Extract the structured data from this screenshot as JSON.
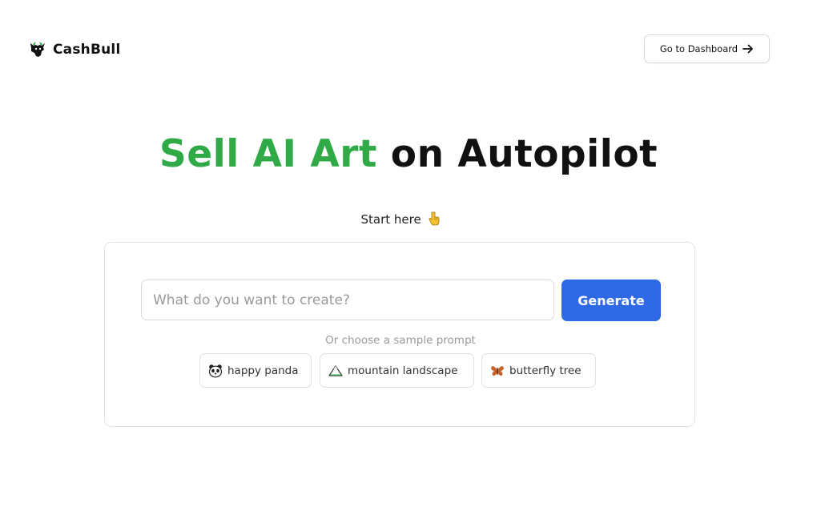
{
  "header": {
    "logo_text": "CashBull",
    "logo_icon": "bull-icon",
    "dashboard_label": "Go to Dashboard",
    "dashboard_icon": "arrow-right-icon"
  },
  "hero": {
    "title_highlight": "Sell AI Art",
    "title_rest": "on Autopilot",
    "highlight_color": "#2faa46"
  },
  "start": {
    "label": "Start here",
    "icon": "pointing-down-hand-icon"
  },
  "prompt": {
    "placeholder": "What do you want to create?",
    "value": "",
    "generate_label": "Generate",
    "generate_color": "#2f6ae6"
  },
  "samples": {
    "label": "Or choose a sample prompt",
    "items": [
      {
        "label": "happy panda",
        "icon": "panda-icon"
      },
      {
        "label": "mountain landscape",
        "icon": "mountain-icon"
      },
      {
        "label": "butterfly tree",
        "icon": "butterfly-icon"
      }
    ]
  }
}
